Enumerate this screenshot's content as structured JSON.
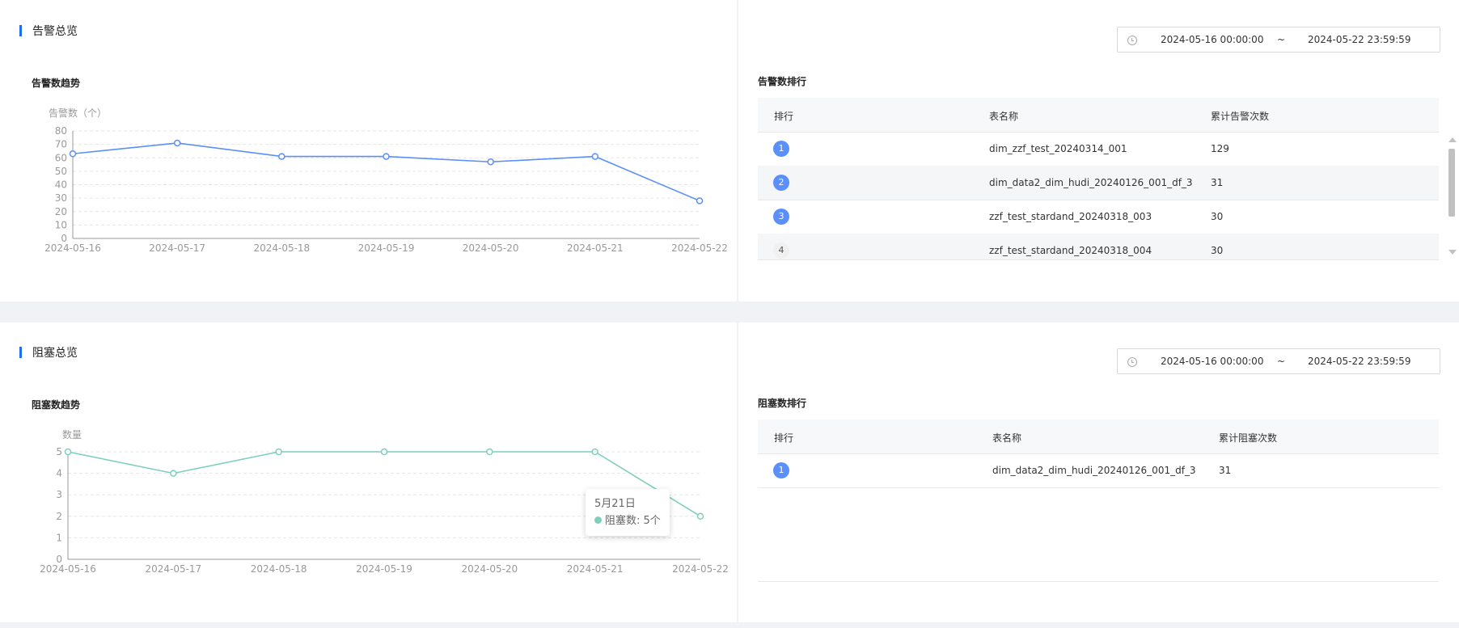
{
  "alarm": {
    "section_title": "告警总览",
    "trend_title": "告警数趋势",
    "rank_title": "告警数排行",
    "date_start": "2024-05-16 00:00:00",
    "date_sep": "~",
    "date_end": "2024-05-22 23:59:59",
    "table": {
      "headers": [
        "排行",
        "表名称",
        "累计告警次数"
      ],
      "rows": [
        {
          "rank": "1",
          "name": "dim_zzf_test_20240314_001",
          "count": "129"
        },
        {
          "rank": "2",
          "name": "dim_data2_dim_hudi_20240126_001_df_3",
          "count": "31"
        },
        {
          "rank": "3",
          "name": "zzf_test_stardand_20240318_003",
          "count": "30"
        },
        {
          "rank": "4",
          "name": "zzf_test_stardand_20240318_004",
          "count": "30"
        }
      ]
    }
  },
  "block": {
    "section_title": "阻塞总览",
    "trend_title": "阻塞数趋势",
    "rank_title": "阻塞数排行",
    "date_start": "2024-05-16 00:00:00",
    "date_sep": "~",
    "date_end": "2024-05-22 23:59:59",
    "tooltip_date": "5月21日",
    "tooltip_text": "阻塞数: 5个",
    "table": {
      "headers": [
        "排行",
        "表名称",
        "累计阻塞次数"
      ],
      "rows": [
        {
          "rank": "1",
          "name": "dim_data2_dim_hudi_20240126_001_df_3",
          "count": "31"
        }
      ]
    }
  },
  "colors": {
    "alarm_line": "#5b8ff9",
    "block_line": "#7ecfbd",
    "accent": "#1d6ff0"
  },
  "chart_data": [
    {
      "type": "line",
      "ylabel": "告警数（个）",
      "x": [
        "2024-05-16",
        "2024-05-17",
        "2024-05-18",
        "2024-05-19",
        "2024-05-20",
        "2024-05-21",
        "2024-05-22"
      ],
      "series": [
        {
          "values": [
            63,
            71,
            61,
            61,
            57,
            61,
            28
          ]
        }
      ],
      "ylim": [
        0,
        80
      ],
      "yticks": [
        0,
        10,
        20,
        30,
        40,
        50,
        60,
        70,
        80
      ],
      "grid": true
    },
    {
      "type": "line",
      "ylabel": "数量",
      "x": [
        "2024-05-16",
        "2024-05-17",
        "2024-05-18",
        "2024-05-19",
        "2024-05-20",
        "2024-05-21",
        "2024-05-22"
      ],
      "series": [
        {
          "name": "阻塞数",
          "values": [
            5,
            4,
            5,
            5,
            5,
            5,
            2
          ]
        }
      ],
      "ylim": [
        0,
        5
      ],
      "yticks": [
        0,
        1,
        2,
        3,
        4,
        5
      ],
      "grid": true
    }
  ]
}
